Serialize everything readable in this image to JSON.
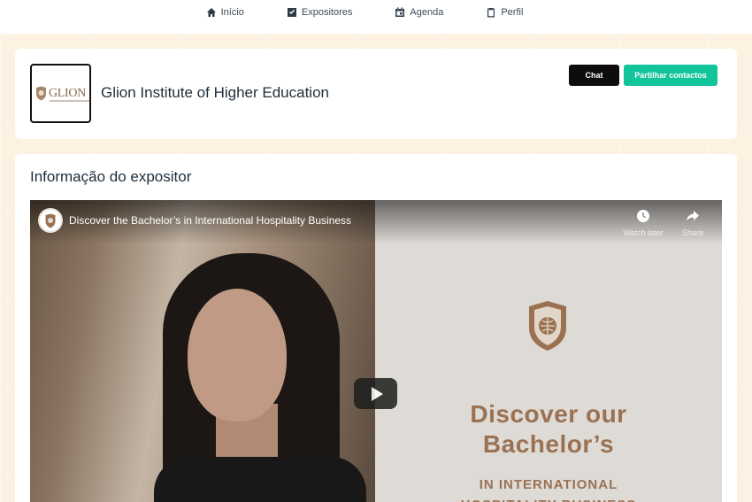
{
  "nav": {
    "items": [
      {
        "label": "Início",
        "icon": "home-icon"
      },
      {
        "label": "Expositores",
        "icon": "checkbox-icon"
      },
      {
        "label": "Agenda",
        "icon": "calendar-icon"
      },
      {
        "label": "Perfil",
        "icon": "clipboard-icon"
      }
    ]
  },
  "exhibitor": {
    "logo_text": "GLION",
    "name": "Glion Institute of Higher Education",
    "chat_label": "Chat",
    "share_label": "Partilhar contactos"
  },
  "info": {
    "title": "Informação do expositor"
  },
  "video": {
    "title": "Discover the Bachelor’s in International Hospitality Business",
    "watch_later_label": "Watch later",
    "share_label": "Share",
    "headline_line1": "Discover our",
    "headline_line2": "Bachelor’s",
    "sub_line1": "IN INTERNATIONAL",
    "sub_line2": "HOSPITALITY BUSINESS"
  },
  "colors": {
    "background": "#fdf1e2",
    "accent_green": "#12c49a",
    "brand_brown": "#9a7252",
    "chat_button": "#0d0d0d"
  }
}
